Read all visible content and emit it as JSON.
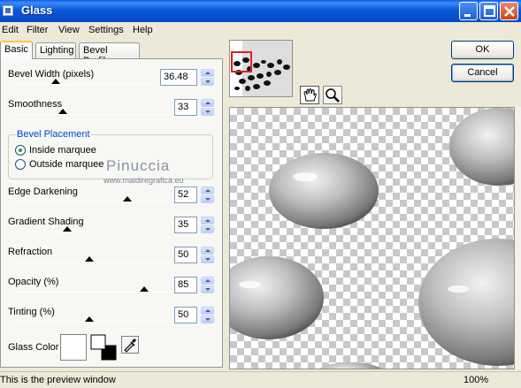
{
  "window": {
    "title": "Glass"
  },
  "menu": [
    "Edit",
    "Filter",
    "View",
    "Settings",
    "Help"
  ],
  "tabs": [
    "Basic",
    "Lighting",
    "Bevel Profile"
  ],
  "params": {
    "bevel_width": {
      "label": "Bevel Width (pixels)",
      "value": "36.48",
      "level": 0.32
    },
    "smoothness": {
      "label": "Smoothness",
      "value": "33",
      "level": 0.33
    },
    "edge_darkening": {
      "label": "Edge Darkening",
      "value": "52",
      "level": 0.74
    },
    "gradient_shading": {
      "label": "Gradient Shading",
      "value": "35",
      "level": 0.36
    },
    "refraction": {
      "label": "Refraction",
      "value": "50",
      "level": 0.5
    },
    "opacity": {
      "label": "Opacity (%)",
      "value": "85",
      "level": 0.85
    },
    "tinting": {
      "label": "Tinting (%)",
      "value": "50",
      "level": 0.5
    }
  },
  "bevel_placement": {
    "title": "Bevel Placement",
    "inside": "Inside marquee",
    "outside": "Outside marquee",
    "selected": "inside"
  },
  "glass_color": {
    "label": "Glass Color",
    "value": "#ffffff"
  },
  "buttons": {
    "ok": "OK",
    "cancel": "Cancel"
  },
  "watermark": {
    "name": "Pinuccia",
    "url": "www.maidiregrafica.eu"
  },
  "status": {
    "text": "This is the preview window",
    "zoom": "100%"
  }
}
